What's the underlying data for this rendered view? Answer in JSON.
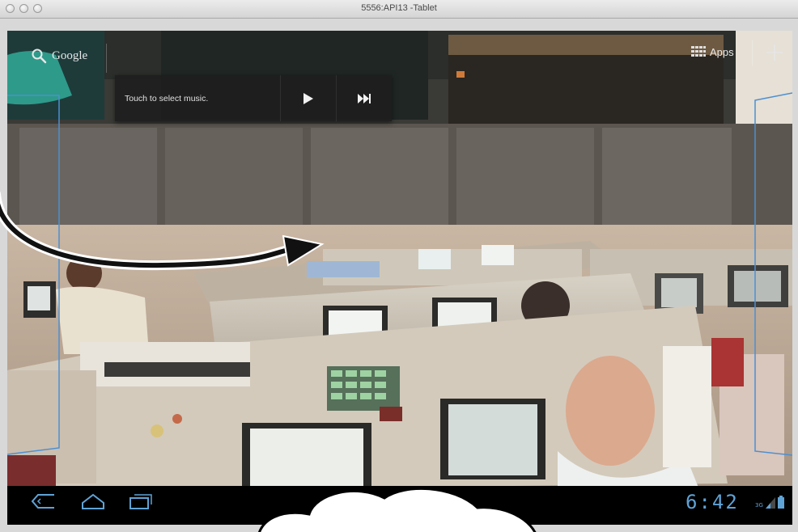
{
  "window": {
    "title": "5556:API13 -Tablet"
  },
  "home_screen": {
    "search": {
      "label": "Google",
      "icon": "search-icon"
    },
    "music_widget": {
      "prompt": "Touch to select music.",
      "play_icon": "play-icon",
      "next_icon": "next-track-icon"
    },
    "apps_button": {
      "label": "Apps",
      "icon": "apps-grid-icon"
    },
    "add_button": {
      "icon": "plus-icon"
    }
  },
  "status_bar": {
    "time": "6:42",
    "network": "3G",
    "icons": [
      "back-icon",
      "home-icon",
      "recent-apps-icon",
      "signal-icon",
      "battery-icon"
    ],
    "accent": "#5fa3d6"
  }
}
